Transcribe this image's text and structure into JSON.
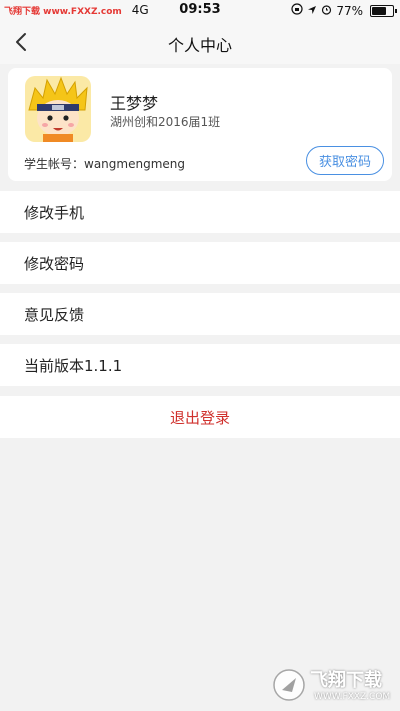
{
  "status_bar": {
    "watermark": "飞翔下载 www.FXXZ.com",
    "carrier": "4G",
    "time": "09:53",
    "battery_text": "77%",
    "battery_level": 0.77
  },
  "nav": {
    "title": "个人中心"
  },
  "profile": {
    "name": "王梦梦",
    "school": "湖州创和2016届1班",
    "account_label": "学生帐号：",
    "account_value": "wangmengmeng",
    "get_password_label": "获取密码"
  },
  "menu": [
    {
      "label": "修改手机"
    },
    {
      "label": "修改密码"
    },
    {
      "label": "意见反馈"
    },
    {
      "label": "当前版本1.1.1"
    }
  ],
  "logout_label": "退出登录",
  "brand": {
    "name": "飞翔下载",
    "url": "WWW.FXXZ.COM"
  },
  "colors": {
    "accent_blue": "#4a90e2",
    "logout_red": "#d0312d",
    "background": "#f2f2f2"
  }
}
